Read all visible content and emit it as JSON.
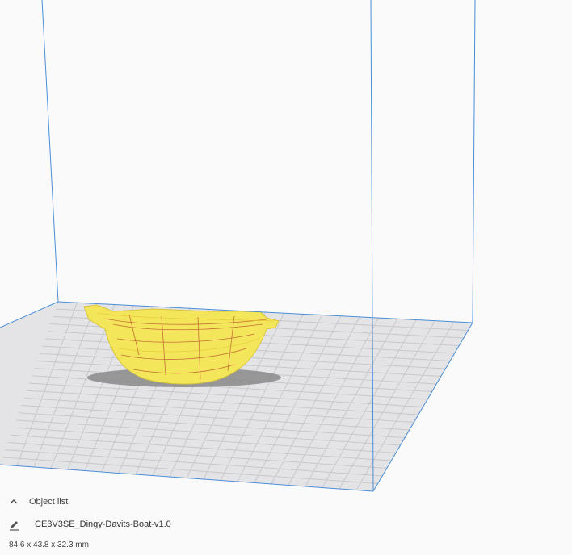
{
  "viewport": {
    "volume_outline_color": "#4a8ed6",
    "plate_color": "#e4e4e7",
    "grid_line_color": "#c6c8cc",
    "model_color": "#f4e65a",
    "model_shadow_color": "#888888",
    "model_accent_color": "#b33a2a"
  },
  "object_list": {
    "toggle_label": "Object list",
    "toggle_icon": "chevron-up-icon",
    "items": [
      {
        "edit_icon": "pencil-icon",
        "name": "CE3V3SE_Dingy-Davits-Boat-v1.0"
      }
    ],
    "dimensions": "84.6 x 43.8 x 32.3 mm"
  }
}
